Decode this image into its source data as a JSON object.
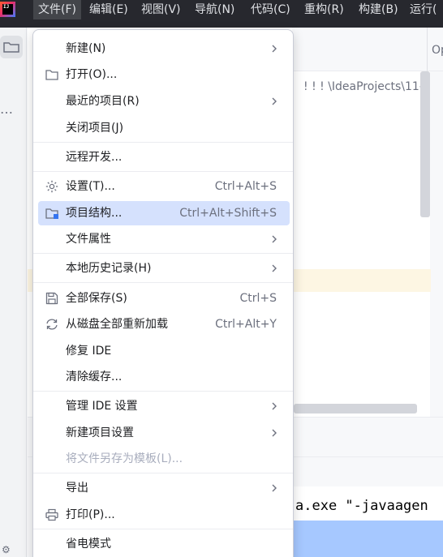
{
  "app": {
    "logo_text": "IJ"
  },
  "menubar": [
    {
      "label": "文件(F)",
      "active": true
    },
    {
      "label": "编辑(E)",
      "active": false
    },
    {
      "label": "视图(V)",
      "active": false
    },
    {
      "label": "导航(N)",
      "active": false
    },
    {
      "label": "代码(C)",
      "active": false
    },
    {
      "label": "重构(R)",
      "active": false
    },
    {
      "label": "构建(B)",
      "active": false
    },
    {
      "label": "运行(",
      "active": false
    }
  ],
  "editor": {
    "tab_fragment": "Op",
    "path_fragment": "! ! ! \\IdeaProjects\\11-",
    "console_fragment": "a.exe \"-javaagen",
    "more_icon": "…"
  },
  "file_menu": {
    "items": [
      {
        "label": "新建(N)",
        "shortcut": "",
        "submenu": true,
        "icon": "none",
        "disabled": false,
        "selected": false
      },
      {
        "label": "打开(O)...",
        "shortcut": "",
        "submenu": false,
        "icon": "folder-icon",
        "disabled": false,
        "selected": false
      },
      {
        "label": "最近的项目(R)",
        "shortcut": "",
        "submenu": true,
        "icon": "none",
        "disabled": false,
        "selected": false
      },
      {
        "label": "关闭项目(J)",
        "shortcut": "",
        "submenu": false,
        "icon": "none",
        "disabled": false,
        "selected": false
      },
      {
        "label": "远程开发...",
        "shortcut": "",
        "submenu": false,
        "icon": "none",
        "disabled": false,
        "selected": false
      },
      {
        "label": "设置(T)...",
        "shortcut": "Ctrl+Alt+S",
        "submenu": false,
        "icon": "gear-icon",
        "disabled": false,
        "selected": false
      },
      {
        "label": "项目结构...",
        "shortcut": "Ctrl+Alt+Shift+S",
        "submenu": false,
        "icon": "project-structure-icon",
        "disabled": false,
        "selected": true
      },
      {
        "label": "文件属性",
        "shortcut": "",
        "submenu": true,
        "icon": "none",
        "disabled": false,
        "selected": false
      },
      {
        "label": "本地历史记录(H)",
        "shortcut": "",
        "submenu": true,
        "icon": "none",
        "disabled": false,
        "selected": false
      },
      {
        "label": "全部保存(S)",
        "shortcut": "Ctrl+S",
        "submenu": false,
        "icon": "save-icon",
        "disabled": false,
        "selected": false
      },
      {
        "label": "从磁盘全部重新加载",
        "shortcut": "Ctrl+Alt+Y",
        "submenu": false,
        "icon": "reload-icon",
        "disabled": false,
        "selected": false
      },
      {
        "label": "修复 IDE",
        "shortcut": "",
        "submenu": false,
        "icon": "none",
        "disabled": false,
        "selected": false
      },
      {
        "label": "清除缓存...",
        "shortcut": "",
        "submenu": false,
        "icon": "none",
        "disabled": false,
        "selected": false
      },
      {
        "label": "管理 IDE 设置",
        "shortcut": "",
        "submenu": true,
        "icon": "none",
        "disabled": false,
        "selected": false
      },
      {
        "label": "新建项目设置",
        "shortcut": "",
        "submenu": true,
        "icon": "none",
        "disabled": false,
        "selected": false
      },
      {
        "label": "将文件另存为模板(L)...",
        "shortcut": "",
        "submenu": false,
        "icon": "none",
        "disabled": true,
        "selected": false
      },
      {
        "label": "导出",
        "shortcut": "",
        "submenu": true,
        "icon": "none",
        "disabled": false,
        "selected": false
      },
      {
        "label": "打印(P)...",
        "shortcut": "",
        "submenu": false,
        "icon": "printer-icon",
        "disabled": false,
        "selected": false
      },
      {
        "label": "省电模式",
        "shortcut": "",
        "submenu": false,
        "icon": "none",
        "disabled": false,
        "selected": false
      }
    ]
  }
}
